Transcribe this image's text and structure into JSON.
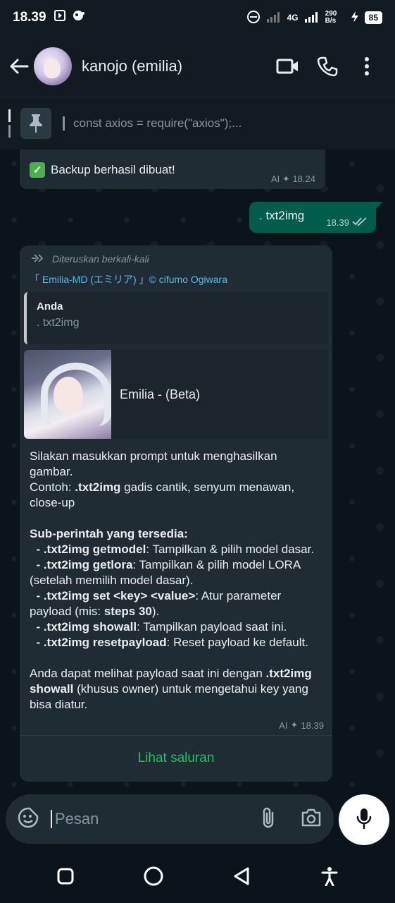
{
  "statusbar": {
    "time": "18.39",
    "network": "4G",
    "speed": "290 B/s",
    "battery": "85"
  },
  "header": {
    "contact_name": "kanojo (emilia)",
    "icons": [
      "back-arrow-icon",
      "video-call-icon",
      "voice-call-icon",
      "more-vertical-icon"
    ]
  },
  "pinned": {
    "text": "const axios = require(\"axios\");..."
  },
  "messages": {
    "backup": {
      "text": "Backup berhasil dibuat!",
      "ai_label": "AI",
      "time": "18.24"
    },
    "outgoing": {
      "text": ". txt2img",
      "time": "18.39"
    },
    "forwarded": {
      "forward_label": "Diteruskan berkali-kali",
      "channel_name": "「 Emilia-MD (エミリア) 」© cifumo Ogiwara",
      "quote_author": "Anda",
      "quote_text": ". txt2img",
      "preview_title": "Emilia - (Beta)",
      "body_intro": "Silakan masukkan prompt untuk menghasilkan gambar.",
      "example_label": "Contoh: ",
      "example_cmd": ".txt2img",
      "example_rest": " gadis cantik, senyum menawan, close-up",
      "subcommands_title": "Sub-perintah yang tersedia:",
      "subcommands": [
        {
          "cmd": "- .txt2img getmodel",
          "desc": ": Tampilkan & pilih model dasar."
        },
        {
          "cmd": "- .txt2img getlora",
          "desc": ": Tampilkan & pilih model LORA (setelah memilih model dasar)."
        },
        {
          "cmd": "- .txt2img set <key> <value>",
          "desc": ": Atur parameter payload (mis: ",
          "extra_bold": "steps 30",
          "extra_tail": ")."
        },
        {
          "cmd": "- .txt2img showall",
          "desc": ": Tampilkan payload saat ini."
        },
        {
          "cmd": "- .txt2img resetpayload",
          "desc": ": Reset payload ke default."
        }
      ],
      "footer_pre": "Anda dapat melihat payload saat ini dengan ",
      "footer_cmd": ".txt2img showall",
      "footer_post": " (khusus owner) untuk mengetahui key yang bisa diatur.",
      "ai_label": "AI",
      "time": "18.39",
      "channel_button": "Lihat saluran"
    }
  },
  "input": {
    "placeholder": "Pesan"
  },
  "colors": {
    "outgoing_bubble": "#005c4b",
    "incoming_bubble": "#1f2c34",
    "accent_green": "#21c063",
    "link_blue": "#53bdeb"
  }
}
